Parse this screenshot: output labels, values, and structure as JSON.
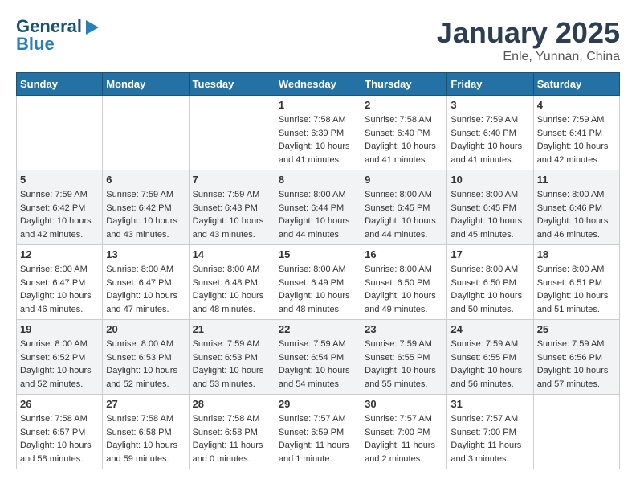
{
  "header": {
    "logo_line1": "General",
    "logo_line2": "Blue",
    "month_title": "January 2025",
    "location": "Enle, Yunnan, China"
  },
  "days_of_week": [
    "Sunday",
    "Monday",
    "Tuesday",
    "Wednesday",
    "Thursday",
    "Friday",
    "Saturday"
  ],
  "weeks": [
    [
      {
        "num": "",
        "info": ""
      },
      {
        "num": "",
        "info": ""
      },
      {
        "num": "",
        "info": ""
      },
      {
        "num": "1",
        "info": "Sunrise: 7:58 AM\nSunset: 6:39 PM\nDaylight: 10 hours\nand 41 minutes."
      },
      {
        "num": "2",
        "info": "Sunrise: 7:58 AM\nSunset: 6:40 PM\nDaylight: 10 hours\nand 41 minutes."
      },
      {
        "num": "3",
        "info": "Sunrise: 7:59 AM\nSunset: 6:40 PM\nDaylight: 10 hours\nand 41 minutes."
      },
      {
        "num": "4",
        "info": "Sunrise: 7:59 AM\nSunset: 6:41 PM\nDaylight: 10 hours\nand 42 minutes."
      }
    ],
    [
      {
        "num": "5",
        "info": "Sunrise: 7:59 AM\nSunset: 6:42 PM\nDaylight: 10 hours\nand 42 minutes."
      },
      {
        "num": "6",
        "info": "Sunrise: 7:59 AM\nSunset: 6:42 PM\nDaylight: 10 hours\nand 43 minutes."
      },
      {
        "num": "7",
        "info": "Sunrise: 7:59 AM\nSunset: 6:43 PM\nDaylight: 10 hours\nand 43 minutes."
      },
      {
        "num": "8",
        "info": "Sunrise: 8:00 AM\nSunset: 6:44 PM\nDaylight: 10 hours\nand 44 minutes."
      },
      {
        "num": "9",
        "info": "Sunrise: 8:00 AM\nSunset: 6:45 PM\nDaylight: 10 hours\nand 44 minutes."
      },
      {
        "num": "10",
        "info": "Sunrise: 8:00 AM\nSunset: 6:45 PM\nDaylight: 10 hours\nand 45 minutes."
      },
      {
        "num": "11",
        "info": "Sunrise: 8:00 AM\nSunset: 6:46 PM\nDaylight: 10 hours\nand 46 minutes."
      }
    ],
    [
      {
        "num": "12",
        "info": "Sunrise: 8:00 AM\nSunset: 6:47 PM\nDaylight: 10 hours\nand 46 minutes."
      },
      {
        "num": "13",
        "info": "Sunrise: 8:00 AM\nSunset: 6:47 PM\nDaylight: 10 hours\nand 47 minutes."
      },
      {
        "num": "14",
        "info": "Sunrise: 8:00 AM\nSunset: 6:48 PM\nDaylight: 10 hours\nand 48 minutes."
      },
      {
        "num": "15",
        "info": "Sunrise: 8:00 AM\nSunset: 6:49 PM\nDaylight: 10 hours\nand 48 minutes."
      },
      {
        "num": "16",
        "info": "Sunrise: 8:00 AM\nSunset: 6:50 PM\nDaylight: 10 hours\nand 49 minutes."
      },
      {
        "num": "17",
        "info": "Sunrise: 8:00 AM\nSunset: 6:50 PM\nDaylight: 10 hours\nand 50 minutes."
      },
      {
        "num": "18",
        "info": "Sunrise: 8:00 AM\nSunset: 6:51 PM\nDaylight: 10 hours\nand 51 minutes."
      }
    ],
    [
      {
        "num": "19",
        "info": "Sunrise: 8:00 AM\nSunset: 6:52 PM\nDaylight: 10 hours\nand 52 minutes."
      },
      {
        "num": "20",
        "info": "Sunrise: 8:00 AM\nSunset: 6:53 PM\nDaylight: 10 hours\nand 52 minutes."
      },
      {
        "num": "21",
        "info": "Sunrise: 7:59 AM\nSunset: 6:53 PM\nDaylight: 10 hours\nand 53 minutes."
      },
      {
        "num": "22",
        "info": "Sunrise: 7:59 AM\nSunset: 6:54 PM\nDaylight: 10 hours\nand 54 minutes."
      },
      {
        "num": "23",
        "info": "Sunrise: 7:59 AM\nSunset: 6:55 PM\nDaylight: 10 hours\nand 55 minutes."
      },
      {
        "num": "24",
        "info": "Sunrise: 7:59 AM\nSunset: 6:55 PM\nDaylight: 10 hours\nand 56 minutes."
      },
      {
        "num": "25",
        "info": "Sunrise: 7:59 AM\nSunset: 6:56 PM\nDaylight: 10 hours\nand 57 minutes."
      }
    ],
    [
      {
        "num": "26",
        "info": "Sunrise: 7:58 AM\nSunset: 6:57 PM\nDaylight: 10 hours\nand 58 minutes."
      },
      {
        "num": "27",
        "info": "Sunrise: 7:58 AM\nSunset: 6:58 PM\nDaylight: 10 hours\nand 59 minutes."
      },
      {
        "num": "28",
        "info": "Sunrise: 7:58 AM\nSunset: 6:58 PM\nDaylight: 11 hours\nand 0 minutes."
      },
      {
        "num": "29",
        "info": "Sunrise: 7:57 AM\nSunset: 6:59 PM\nDaylight: 11 hours\nand 1 minute."
      },
      {
        "num": "30",
        "info": "Sunrise: 7:57 AM\nSunset: 7:00 PM\nDaylight: 11 hours\nand 2 minutes."
      },
      {
        "num": "31",
        "info": "Sunrise: 7:57 AM\nSunset: 7:00 PM\nDaylight: 11 hours\nand 3 minutes."
      },
      {
        "num": "",
        "info": ""
      }
    ]
  ]
}
